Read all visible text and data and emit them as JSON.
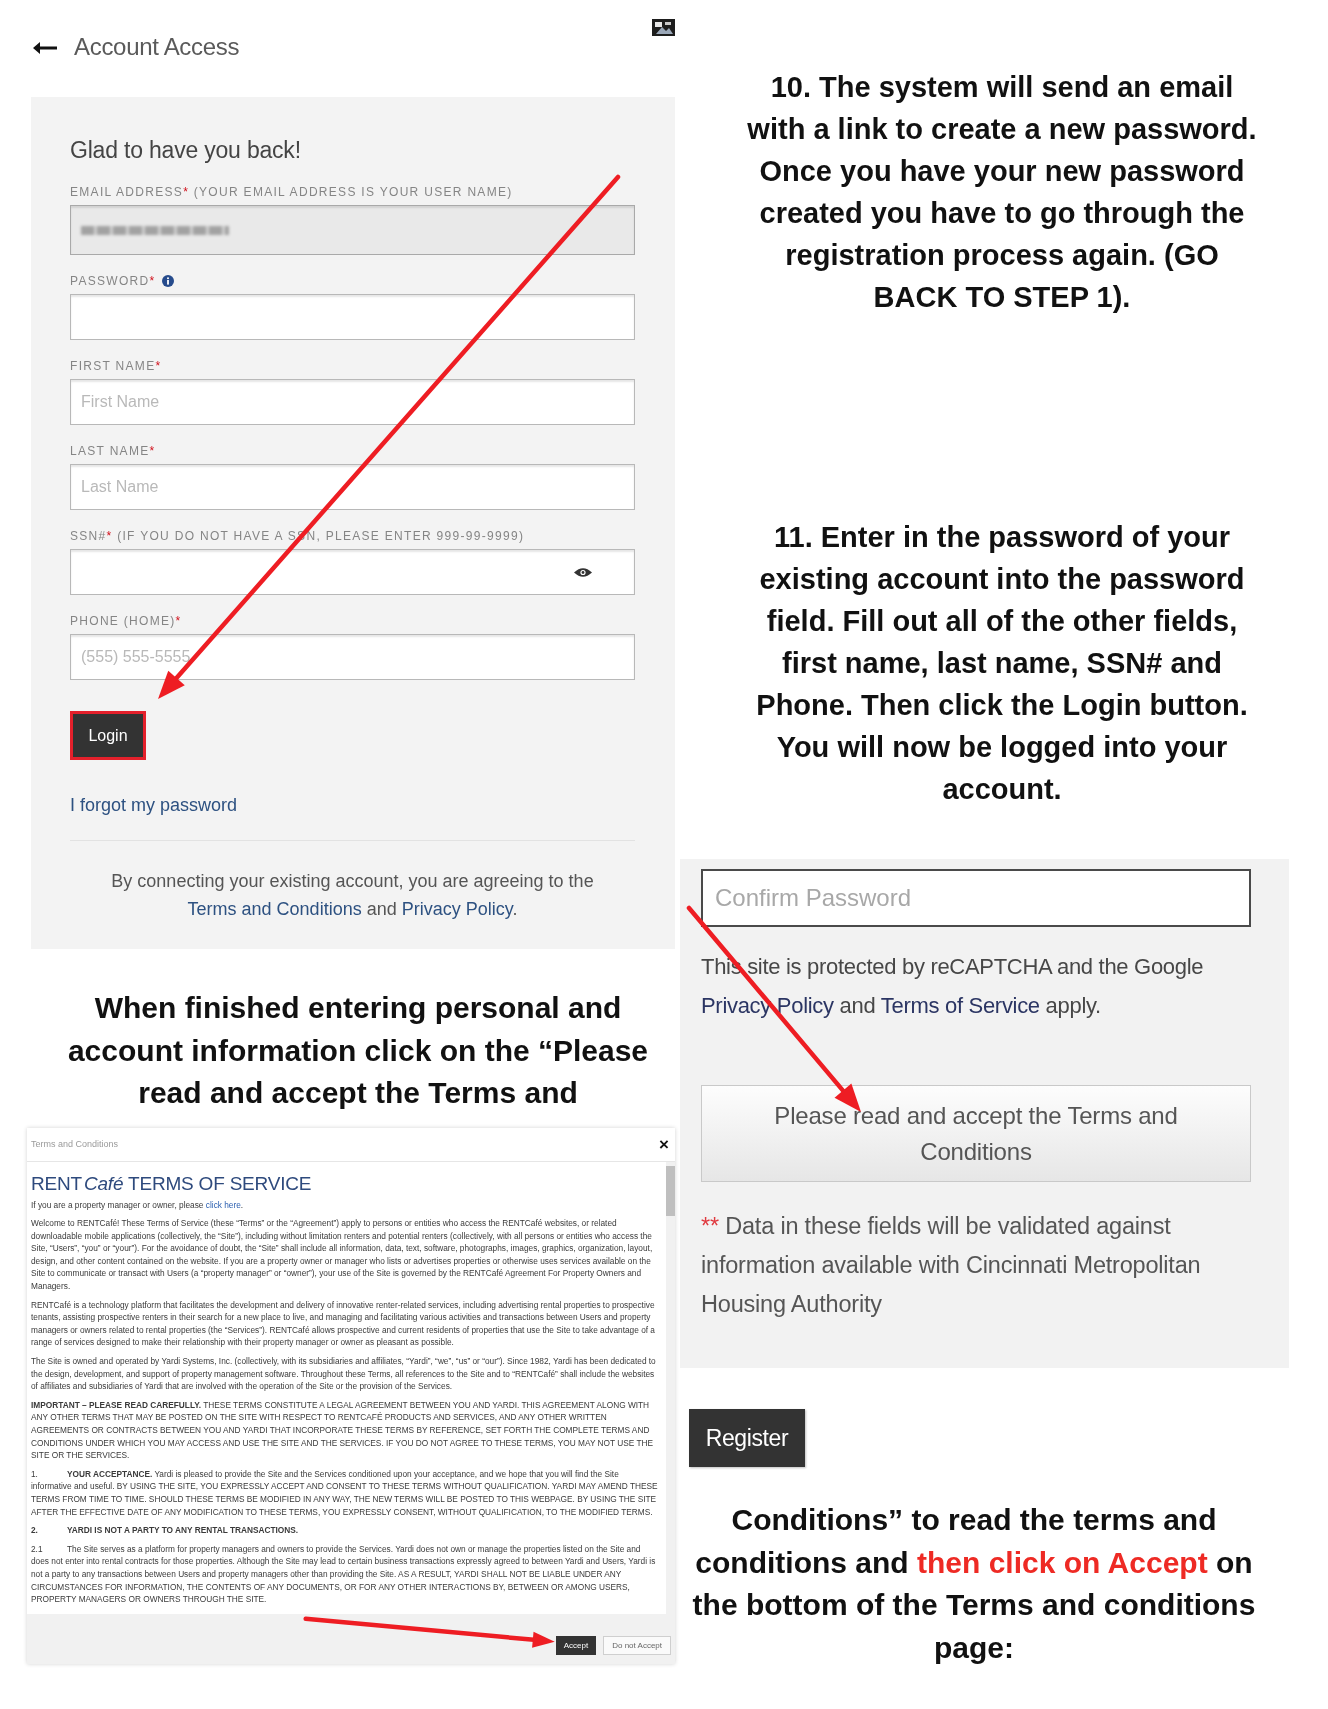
{
  "account_access": {
    "title": "Account Access",
    "greeting": "Glad to have you back!",
    "fields": [
      {
        "kind": "email",
        "label": "EMAIL ADDRESS",
        "required": "*",
        "note": "(YOUR EMAIL ADDRESS IS YOUR USER NAME)",
        "disabled": true
      },
      {
        "kind": "password",
        "label": "PASSWORD",
        "required": "*",
        "disabled": false
      },
      {
        "kind": "text",
        "label": "FIRST NAME",
        "required": "*",
        "placeholder": "First Name",
        "disabled": false
      },
      {
        "kind": "text",
        "label": "LAST NAME",
        "required": "*",
        "placeholder": "Last Name",
        "disabled": false
      },
      {
        "kind": "ssn",
        "label": "SSN#",
        "required": "*",
        "note": "(IF YOU DO NOT HAVE A SSN, PLEASE ENTER 999-99-9999)",
        "disabled": false
      },
      {
        "kind": "text",
        "label": "PHONE (HOME)",
        "required": "*",
        "placeholder": "(555) 555-5555",
        "disabled": false
      }
    ],
    "login_button": {
      "label": "Login",
      "highlighted": true
    },
    "forgot_link": "I forgot my password",
    "agreement": {
      "before": "By connecting your existing account, you are agreeing to the",
      "link_1": "Terms and Conditions",
      "middle": "and",
      "link_2": "Privacy Policy",
      "end": "."
    }
  },
  "steps": [
    {
      "text": "10. The system will send an email with a link to create a new password. Once you have your new password created you have to go through the registration process again. (GO BACK TO STEP 1)."
    },
    {
      "text": "11. Enter in the password of your existing account into the password field. Fill out all of the other fields, first name, last name, SSN# and Phone. Then click the Login button. You will now be logged into your account."
    }
  ],
  "caption": "When finished entering personal and account information click on the “Please read and accept the Terms and",
  "registration": {
    "confirm_password": {
      "placeholder": "Confirm Password"
    },
    "recaptcha_notice": {
      "before": "This site is protected by reCAPTCHA and the Google",
      "link_1": "Privacy Policy",
      "middle": "and",
      "link_2": "Terms of Service",
      "end": "apply."
    },
    "terms_button": "Please read and accept the Terms and Conditions",
    "validation_note": {
      "mark": "**",
      "text": "Data in these fields will be validated against information available with Cincinnati Metropolitan Housing Authority"
    },
    "register_button": "Register"
  },
  "caption_continued": {
    "before": "Conditions” to read the terms and conditions and",
    "highlight": "then click on Accept",
    "after": "on the bottom of the Terms and conditions page:"
  },
  "terms_dialog": {
    "header": "Terms and Conditions",
    "close": "×",
    "title": {
      "prefix": "RENT",
      "brand": "Café",
      "rest": "TERMS OF SERVICE"
    },
    "intro": {
      "before": "If you are a property manager or owner, please",
      "link": "click here",
      "end": "."
    },
    "sections": [
      {
        "kind": "paragraph",
        "text": "Welcome to RENTCafé! These Terms of Service (these “Terms” or the “Agreement”) apply to persons or entities who access the RENTCafé websites, or related downloadable mobile applications (collectively, the “Site”), including without limitation renters and potential renters (collectively, with all persons or entities who access the Site, “Users”, “you” or “your”). For the avoidance of doubt, the “Site” shall include all information, data, text, software, photographs, images, graphics, organization, layout, design, and other content contained on the website. If you are a property owner or manager who lists or advertises properties or otherwise uses services available on the Site to communicate or transact with Users (a “property manager” or “owner”), your use of the Site is governed by the RENTCafé Agreement For Property Owners and Managers."
      },
      {
        "kind": "paragraph",
        "text": "RENTCafé is a technology platform that facilitates the development and delivery of innovative renter-related services, including advertising rental properties to prospective tenants, assisting prospective renters in their search for a new place to live, and managing and facilitating various activities and transactions between Users and property managers or owners related to rental properties (the “Services”). RENTCafé allows prospective and current residents of properties that use the Site to take advantage of a range of services designed to make their relationship with their property manager or owner as pleasant as possible."
      },
      {
        "kind": "paragraph",
        "text": "The Site is owned and operated by Yardi Systems, Inc. (collectively, with its subsidiaries and affiliates, “Yardi”, “we”, “us” or “our”). Since 1982, Yardi has been dedicated to the design, development, and support of property management software. Throughout these Terms, all references to the Site and to “RENTCafé” shall include the websites of affiliates and subsidiaries of Yardi that are involved with the operation of the Site or the provision of the Services."
      },
      {
        "kind": "paragraph",
        "text": "**IMPORTANT – PLEASE READ CAREFULLY.** THESE TERMS CONSTITUTE A LEGAL AGREEMENT BETWEEN YOU AND YARDI. THIS AGREEMENT ALONG WITH ANY OTHER TERMS THAT MAY BE POSTED ON THE SITE WITH RESPECT TO RENTCAFÉ PRODUCTS AND SERVICES, AND ANY OTHER WRITTEN AGREEMENTS OR CONTRACTS BETWEEN YOU AND YARDI THAT INCORPORATE THESE TERMS BY REFERENCE, SET FORTH THE COMPLETE TERMS AND CONDITIONS UNDER WHICH YOU MAY ACCESS AND USE THE SITE AND THE SERVICES. IF YOU DO NOT AGREE TO THESE TERMS, YOU MAY NOT USE THE SITE OR THE SERVICES."
      },
      {
        "kind": "numbered",
        "number": "1.",
        "text": "**YOUR ACCEPTANCE.** Yardi is pleased to provide the Site and the Services conditioned upon your acceptance, and we hope that you will find the Site informative and useful. BY USING THE SITE, YOU EXPRESSLY ACCEPT AND CONSENT TO THESE TERMS WITHOUT QUALIFICATION. YARDI MAY AMEND THESE TERMS FROM TIME TO TIME. SHOULD THESE TERMS BE MODIFIED IN ANY WAY, THE NEW TERMS WILL BE POSTED TO THIS WEBPAGE. BY USING THE SITE AFTER THE EFFECTIVE DATE OF ANY MODIFICATION TO THESE TERMS, YOU EXPRESSLY CONSENT, WITHOUT QUALIFICATION, TO THE MODIFIED TERMS."
      },
      {
        "kind": "heading",
        "number": "2.",
        "text": "YARDI IS NOT A PARTY TO ANY RENTAL TRANSACTIONS."
      },
      {
        "kind": "numbered",
        "number": "2.1",
        "text": "The Site serves as a platform for property managers and owners to provide the Services. Yardi does not own or manage the properties listed on the Site and does not enter into rental contracts for those properties. Although the Site may lead to certain business transactions expressly agreed to between Yardi and Users, Yardi is not a party to any transactions between Users and property managers other than providing the Site. AS A RESULT, YARDI SHALL NOT BE LIABLE UNDER ANY CIRCUMSTANCES FOR INFORMATION, THE CONTENTS OF ANY DOCUMENTS, OR FOR ANY OTHER INTERACTIONS BY, BETWEEN OR AMONG USERS, PROPERTY MANAGERS OR OWNERS THROUGH THE SITE."
      }
    ],
    "buttons": [
      {
        "kind": "primary",
        "label": "Accept"
      },
      {
        "kind": "secondary",
        "label": "Do not Accept"
      }
    ]
  }
}
